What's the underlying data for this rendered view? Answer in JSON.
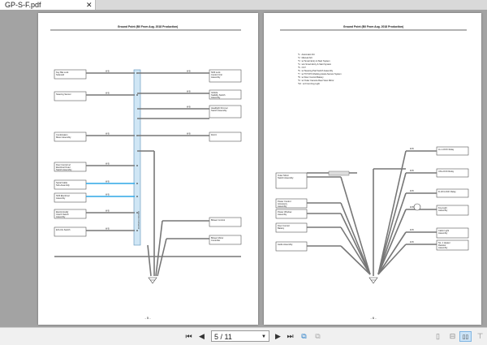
{
  "tab": {
    "title": "GP-S-F.pdf",
    "close_icon": "close-icon"
  },
  "pages": [
    {
      "title": "Ground Point (B/I From Aug. 2018 Production)",
      "number": "- 5 -",
      "left_boxes": [
        "Key Bat Lock Solenoid",
        "Steering Sensor",
        "Combination Meter Assembly",
        "Door Control w/ Electrical Outer Switch Assembly",
        "Spiral Cable Sub-Assembly",
        "Shift Electrical Assembly",
        "Electronically Clutch Switch Assembly",
        "ECU-IG Switch"
      ],
      "right_boxes": [
        "Shift Lock Control Unit Assembly",
        "Vehicle Stability Switch Assembly",
        "Headlight Dimmer Switch Assembly",
        "DLC3",
        "Blower Control",
        "Blower Motor Controller"
      ],
      "wire_label": "W-B",
      "bus_label": "Junction Connector"
    },
    {
      "title": "Ground Point (B/I From Aug. 2018 Production)",
      "number": "- 6 -",
      "legend": [
        "*1 : Automatic A/C",
        "*2 : Manual A/C",
        "*3 : w/ Smart Entry & Start System",
        "*4 : w/o Smart Entry & Start System",
        "*5 : CVT",
        "*6 : w/ Steering Pad Switch Assembly",
        "*7 : w/ TOYOTA Parking Assist-Sensor System",
        "*8 : w/ Door Control Battery",
        "*9 : w/ Outer Camera Rear View Mirror",
        "*10 : w/ Front Fog Light"
      ],
      "left_boxes": [
        "Outer Mirror Switch Assembly",
        "Power Control Accessory Assembly",
        "Power Window Assembly",
        "Door Control Battery",
        "Audio Assembly"
      ],
      "right_boxes": [
        "H-L LOCK Relay",
        "UN-LOCK Relay",
        "D-UN LOCK Relay",
        "Fog Light Assembly",
        "Cabin Light Assembly",
        "No. 1 Heater Resistor Assembly",
        "Fuel Pump Assembly"
      ],
      "wire_label": "W-B"
    }
  ],
  "toolbar": {
    "page_value": "5 / 11",
    "buttons": [
      {
        "name": "first-page-button",
        "icon": "first-page-icon",
        "glyph": "⏮"
      },
      {
        "name": "previous-page-button",
        "icon": "previous-page-icon",
        "glyph": "◀"
      },
      {
        "name": "next-page-button",
        "icon": "next-page-icon",
        "glyph": "▶"
      },
      {
        "name": "last-page-button",
        "icon": "last-page-icon",
        "glyph": "⏭"
      },
      {
        "name": "previous-view-button",
        "icon": "previous-view-icon",
        "glyph": "⧉"
      },
      {
        "name": "next-view-button",
        "icon": "next-view-icon",
        "glyph": "⧉"
      }
    ],
    "view_buttons": [
      {
        "name": "single-page-button",
        "icon": "single-page-icon",
        "glyph": "▯"
      },
      {
        "name": "continuous-button",
        "icon": "continuous-icon",
        "glyph": "⊟"
      },
      {
        "name": "facing-pages-button",
        "icon": "facing-pages-icon",
        "glyph": "▯▯",
        "active": true
      },
      {
        "name": "book-view-button",
        "icon": "book-view-icon",
        "glyph": "⊤"
      }
    ]
  },
  "colors": {
    "highlight_wire": "#2ea7e6",
    "bus_fill": "#cfe6f5",
    "wire": "#777777",
    "background": "#a3a3a3"
  }
}
